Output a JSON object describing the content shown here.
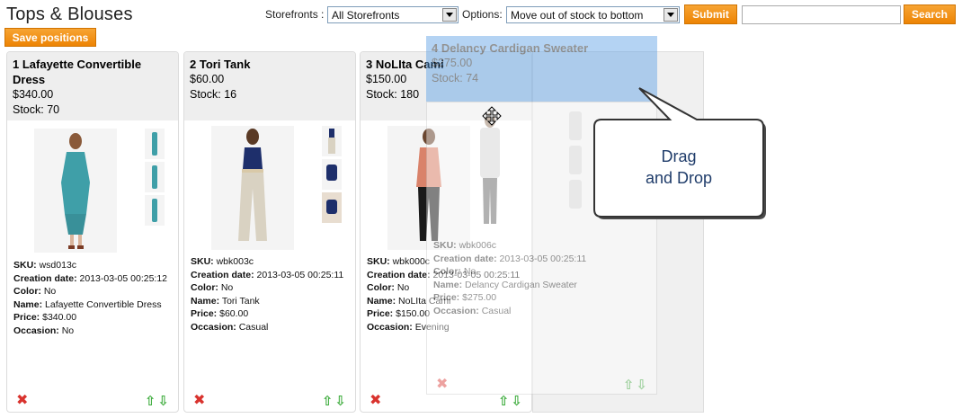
{
  "page": {
    "title": "Tops & Blouses"
  },
  "toolbar": {
    "storefronts_label": "Storefronts :",
    "storefronts_value": "All Storefronts",
    "options_label": "Options:",
    "options_value": "Move out of stock to bottom",
    "submit_label": "Submit",
    "search_value": "",
    "search_label": "Search",
    "save_positions_label": "Save positions"
  },
  "labels": {
    "sku": "SKU:",
    "creation_date": "Creation date:",
    "color": "Color:",
    "name": "Name:",
    "price": "Price:",
    "occasion": "Occasion:"
  },
  "products": [
    {
      "title": "1 Lafayette Convertible Dress",
      "price": "$340.00",
      "stock": "Stock: 70",
      "sku": "wsd013c",
      "creation_date": "2013-03-05 00:25:12",
      "color": "No",
      "name": "Lafayette Convertible Dress",
      "price_detail": "$340.00",
      "occasion": "No"
    },
    {
      "title": "2 Tori Tank",
      "price": "$60.00",
      "stock": "Stock: 16",
      "sku": "wbk003c",
      "creation_date": "2013-03-05 00:25:11",
      "color": "No",
      "name": "Tori Tank",
      "price_detail": "$60.00",
      "occasion": "Casual"
    },
    {
      "title": "3 NoLIta Cami",
      "price": "$150.00",
      "stock": "Stock: 180",
      "sku": "wbk000c",
      "creation_date": "2013-03-05 00:25:11",
      "color": "No",
      "name": "NoLIta Cami",
      "price_detail": "$150.00",
      "occasion": "Evening"
    }
  ],
  "dragged": {
    "title": "4 Delancy Cardigan Sweater",
    "price": "$275.00",
    "stock": "Stock: 74",
    "sku": "wbk006c",
    "creation_date": "2013-03-05 00:25:11",
    "color": "No",
    "name": "Delancy Cardigan Sweater",
    "price_detail": "$275.00",
    "occasion": "Casual"
  },
  "callout": {
    "line1": "Drag",
    "line2": "and Drop"
  },
  "icons": {
    "delete": "delete-x-icon",
    "move_up": "arrow-up-icon",
    "move_down": "arrow-down-icon",
    "move_cursor": "move-cursor-icon"
  },
  "colors": {
    "accent": "#f08c10",
    "drag_highlight": "#5aa0e6",
    "callout_text": "#1f3c6a",
    "delete": "#d9332e",
    "arrows": "#3cab3b"
  }
}
